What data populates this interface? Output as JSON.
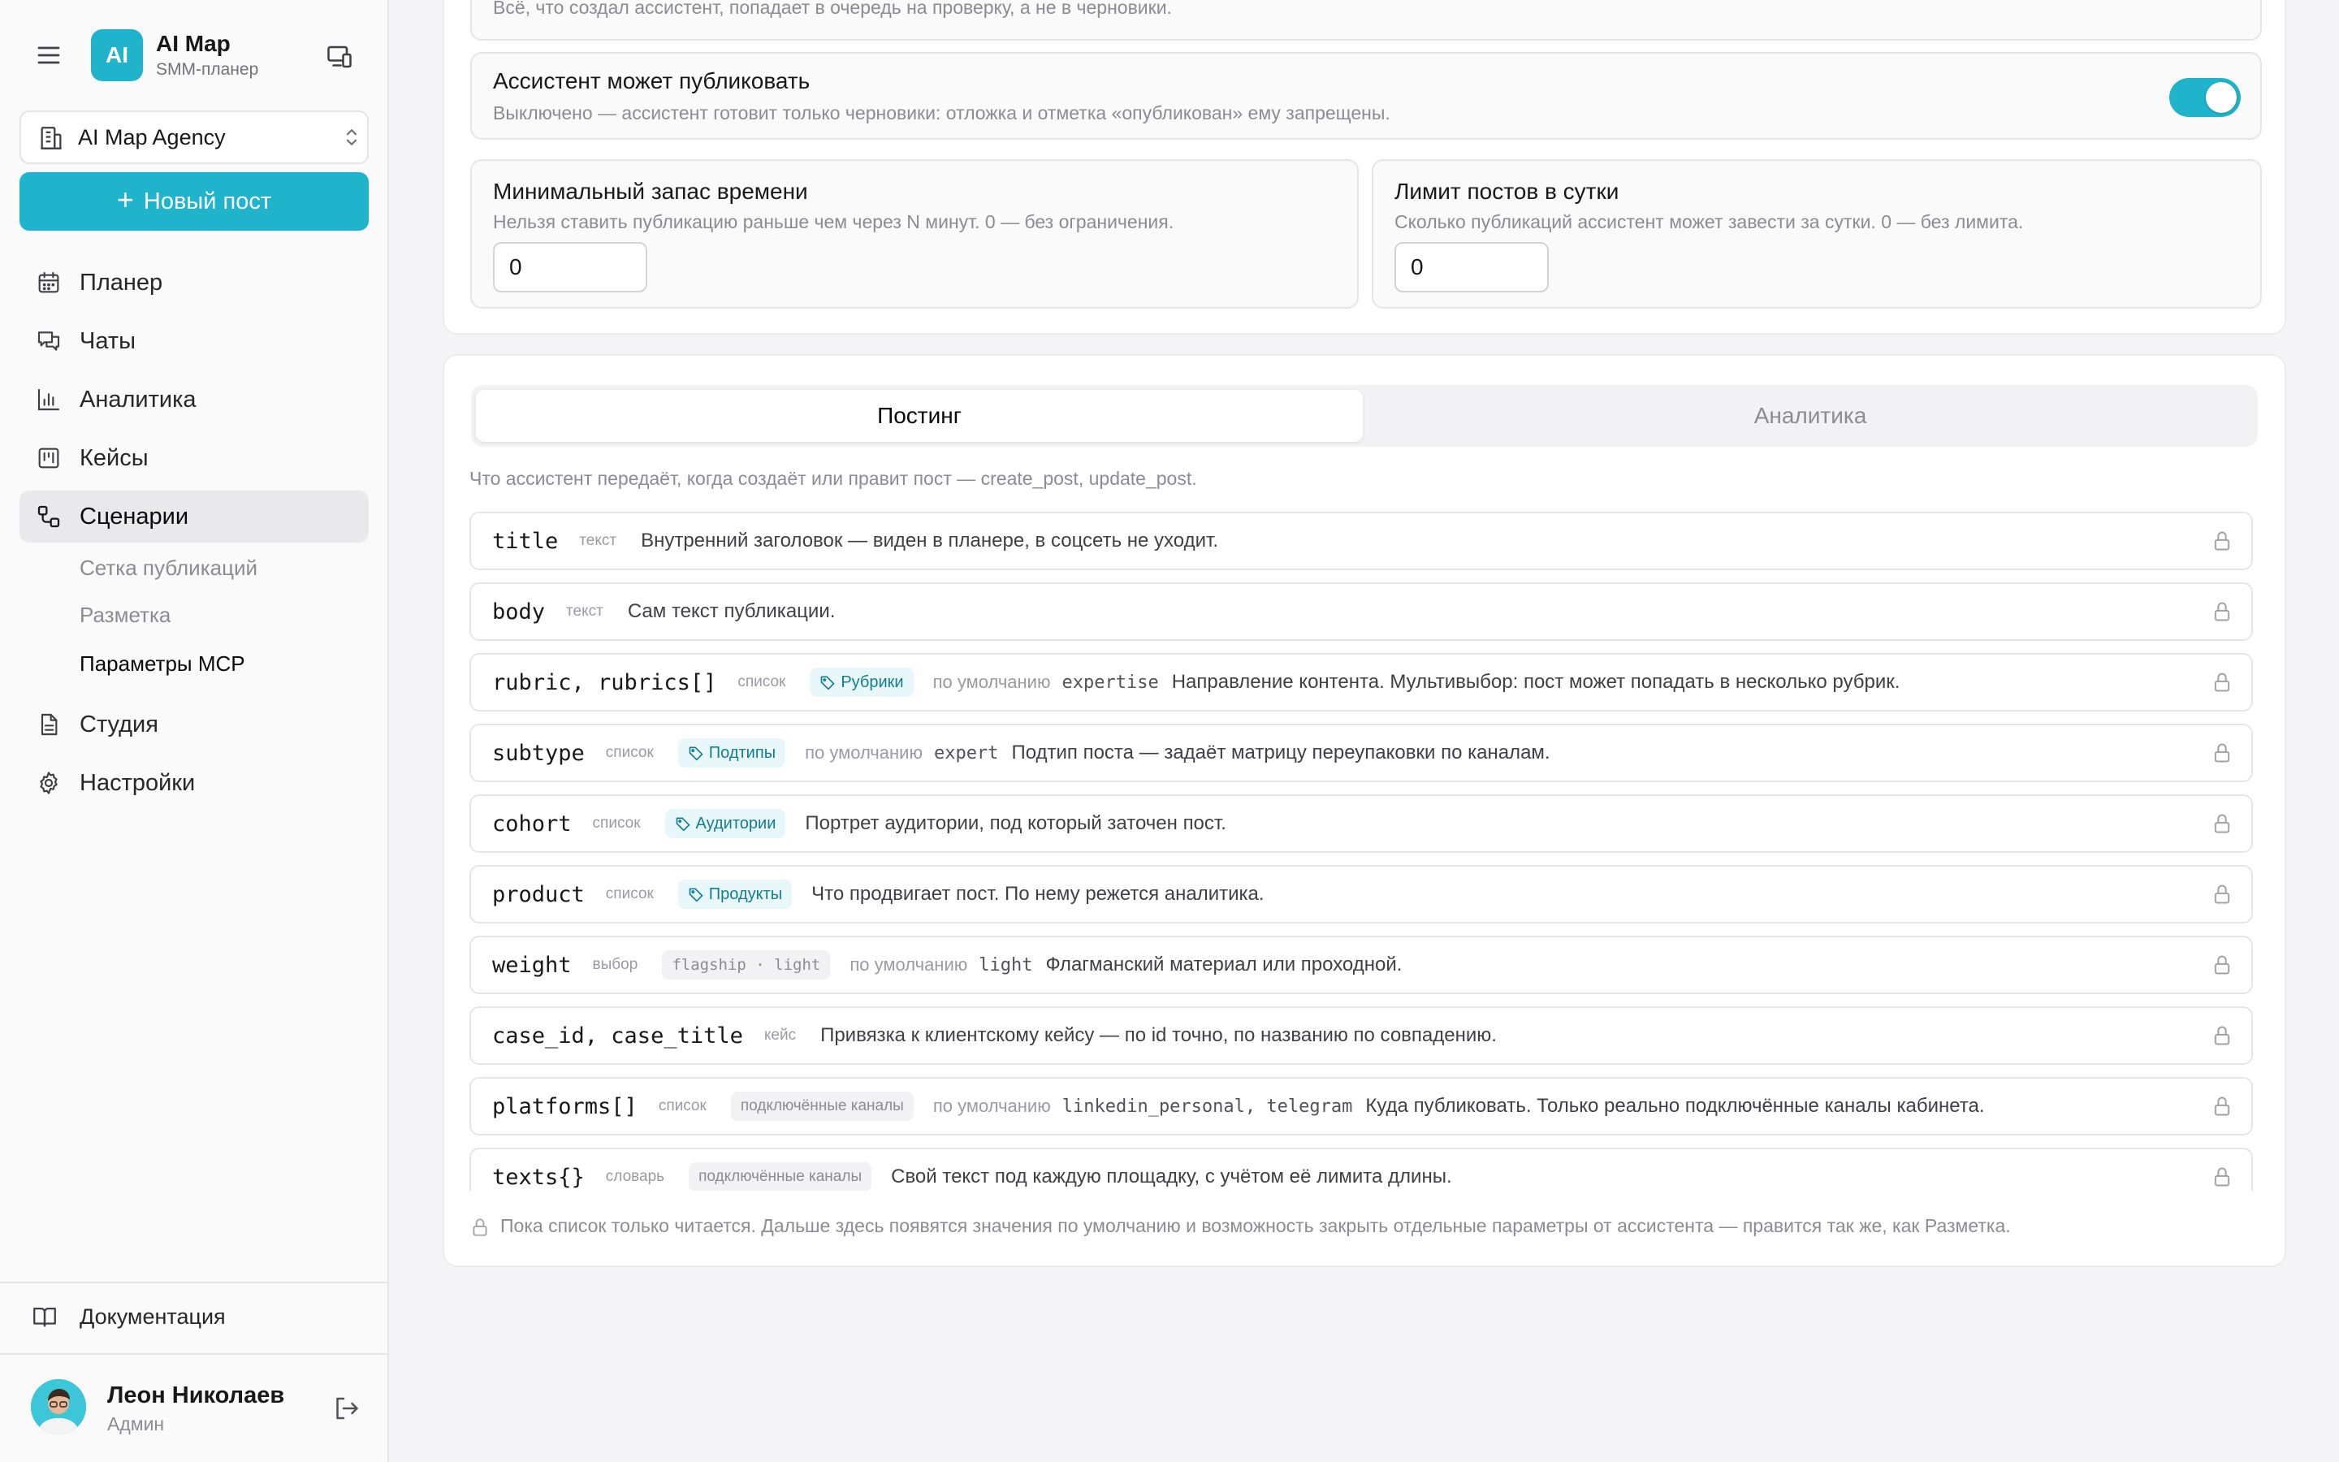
{
  "brand": {
    "logo": "AI",
    "title": "AI Map",
    "subtitle": "SMM-планер"
  },
  "workspace": {
    "name": "AI Map Agency"
  },
  "new_post_label": "Новый пост",
  "nav": {
    "planner": "Планер",
    "chats": "Чаты",
    "analytics": "Аналитика",
    "cases": "Кейсы",
    "scenarios": "Сценарии",
    "scenarios_sub": [
      "Сетка публикаций",
      "Разметка",
      "Параметры MCP"
    ],
    "studio": "Студия",
    "settings": "Настройки"
  },
  "docs_label": "Документация",
  "user": {
    "name": "Леон Николаев",
    "role": "Админ"
  },
  "settings": {
    "top_desc": "Всё, что создал ассистент, попадает в очередь на проверку, а не в черновики.",
    "publish": {
      "title": "Ассистент может публиковать",
      "desc": "Выключено — ассистент готовит только черновики: отложка и отметка «опубликован» ему запрещены.",
      "enabled": true
    },
    "min_time": {
      "title": "Минимальный запас времени",
      "desc": "Нельзя ставить публикацию раньше чем через N минут. 0 — без ограничения.",
      "value": "0"
    },
    "daily_limit": {
      "title": "Лимит постов в сутки",
      "desc": "Сколько публикаций ассистент может завести за сутки. 0 — без лимита.",
      "value": "0"
    }
  },
  "tabs": {
    "posting": "Постинг",
    "analytics": "Аналитика"
  },
  "posting_hint": "Что ассистент передаёт, когда создаёт или правит пост — create_post, update_post.",
  "default_prefix": "по умолчанию",
  "params": {
    "title": {
      "name": "title",
      "type": "текст",
      "desc": "Внутренний заголовок — виден в планере, в соцсеть не уходит."
    },
    "body": {
      "name": "body",
      "type": "текст",
      "desc": "Сам текст публикации."
    },
    "rubric": {
      "name": "rubric, rubrics[]",
      "type": "список",
      "chip": "Рубрики",
      "default": "expertise",
      "desc": "Направление контента. Мультивыбор: пост может попадать в несколько рубрик."
    },
    "subtype": {
      "name": "subtype",
      "type": "список",
      "chip": "Подтипы",
      "default": "expert",
      "desc": "Подтип поста — задаёт матрицу переупаковки по каналам."
    },
    "cohort": {
      "name": "cohort",
      "type": "список",
      "chip": "Аудитории",
      "desc": "Портрет аудитории, под который заточен пост."
    },
    "product": {
      "name": "product",
      "type": "список",
      "chip": "Продукты",
      "desc": "Что продвигает пост. По нему режется аналитика."
    },
    "weight": {
      "name": "weight",
      "type": "выбор",
      "options": "flagship · light",
      "default": "light",
      "desc": "Флагманский материал или проходной."
    },
    "case": {
      "name": "case_id, case_title",
      "type": "кейс",
      "desc": "Привязка к клиентскому кейсу — по id точно, по названию по совпадению."
    },
    "platforms": {
      "name": "platforms[]",
      "type": "список",
      "source": "подключённые каналы",
      "default": "linkedin_personal, telegram",
      "desc": "Куда публиковать. Только реально подключённые каналы кабинета."
    },
    "texts": {
      "name": "texts{}",
      "type": "словарь",
      "source": "подключённые каналы",
      "desc": "Свой текст под каждую площадку, с учётом её лимита длины."
    }
  },
  "footnote": "Пока список только читается. Дальше здесь появятся значения по умолчанию и возможность закрыть отдельные параметры от ассистента — правится так же, как Разметка.",
  "colors": {
    "accent": "#1fb3cc",
    "chip_bg": "#e8f7fa",
    "chip_text": "#137d8f"
  }
}
